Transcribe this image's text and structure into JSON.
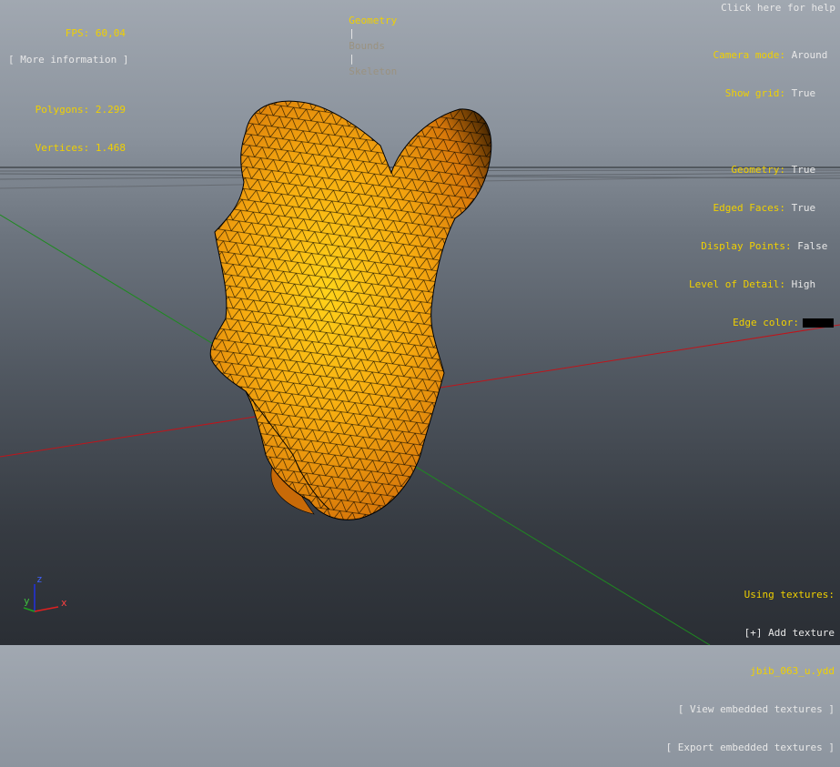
{
  "colors": {
    "label": "#f0d000",
    "value": "#e8e8e8",
    "mesh_fill": "#f2a50a",
    "mesh_highlight": "#ffd21a",
    "mesh_shadow": "#1a1000",
    "edge_color": "#000000",
    "grid_x_axis": "#c0141a",
    "grid_y_axis": "#1e8a20"
  },
  "stats": {
    "fps_label": "FPS:",
    "fps_value": "60,04",
    "polygons_label": "Polygons:",
    "polygons_value": "2.299",
    "vertices_label": "Vertices:",
    "vertices_value": "1.468",
    "more_info": "[ More information ]"
  },
  "tabs": {
    "geometry": "Geometry",
    "sep1": "|",
    "bounds": "Bounds",
    "sep2": "|",
    "skeleton": "Skeleton"
  },
  "help": "Click here for help",
  "settings": {
    "camera_mode_label": "Camera mode:",
    "camera_mode_value": "Around",
    "show_grid_label": "Show grid:",
    "show_grid_value": "True",
    "geometry_label": "Geometry:",
    "geometry_value": "True",
    "edged_faces_label": "Edged Faces:",
    "edged_faces_value": "True",
    "display_points_label": "Display Points:",
    "display_points_value": "False",
    "lod_label": "Level of Detail:",
    "lod_value": "High",
    "edge_color_label": "Edge color:"
  },
  "textures": {
    "heading": "Using textures:",
    "add": "[+] Add texture",
    "file": "jbib_063_u.ydd",
    "view": "[ View embedded textures ]",
    "export": "[ Export embedded textures ]"
  },
  "gizmo": {
    "z": "z",
    "y": "y",
    "x": "x"
  }
}
